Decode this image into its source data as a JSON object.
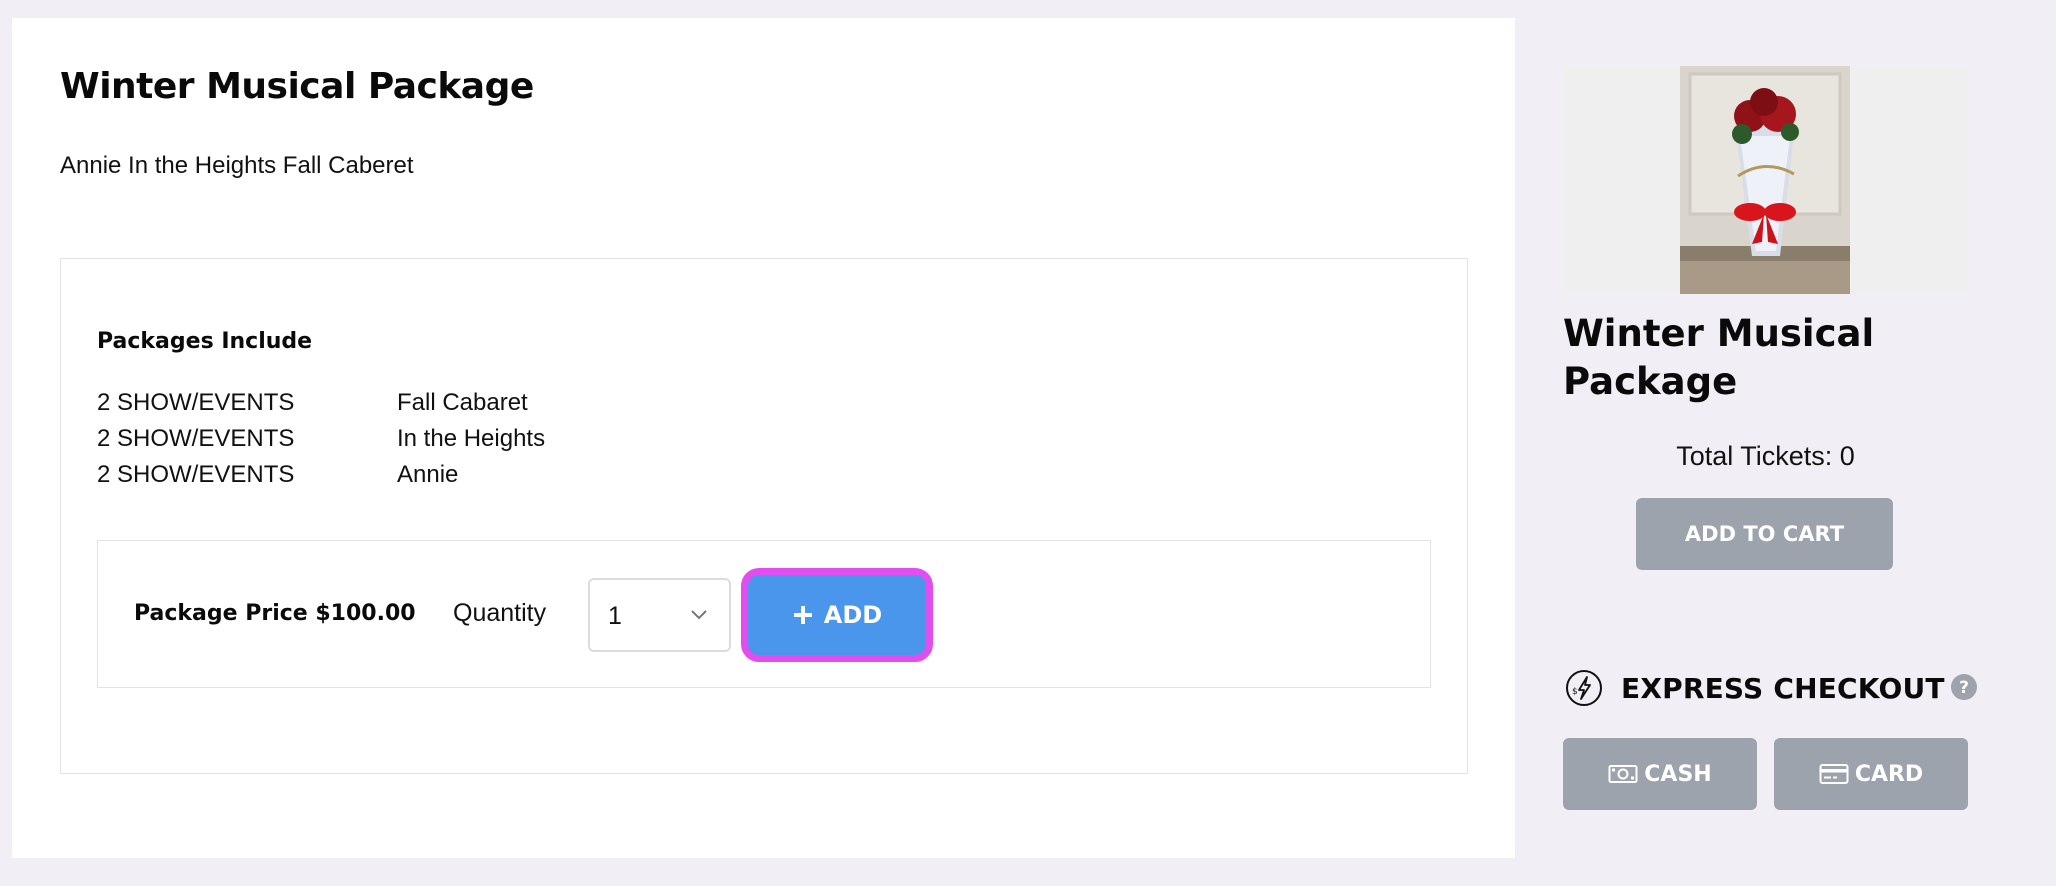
{
  "main": {
    "title": "Winter Musical Package",
    "subtitle": "Annie In the Heights Fall Caberet",
    "includes_heading": "Packages Include",
    "includes": [
      {
        "qty": "2 SHOW/EVENTS",
        "name": "Fall Cabaret"
      },
      {
        "qty": "2 SHOW/EVENTS",
        "name": "In the Heights"
      },
      {
        "qty": "2 SHOW/EVENTS",
        "name": "Annie"
      }
    ],
    "price_label": "Package Price $100.00",
    "quantity_label": "Quantity",
    "quantity_value": "1",
    "add_label": "ADD"
  },
  "side": {
    "title": "Winter Musical Package",
    "total_tickets": "Total Tickets: 0",
    "add_to_cart": "ADD TO CART",
    "express_checkout": "EXPRESS CHECKOUT",
    "cash_label": "CASH",
    "card_label": "CARD"
  },
  "icons": {
    "add": "plus-icon",
    "quantity": "chevron-down-icon",
    "express": "lightning-dollar-icon",
    "help": "question-icon",
    "cash": "cash-icon",
    "card": "credit-card-icon"
  },
  "colors": {
    "add_button": "#4a96ec",
    "add_button_highlight": "#e24df0",
    "disabled_button": "#9ca3ad",
    "page_background": "#f1eff5"
  }
}
